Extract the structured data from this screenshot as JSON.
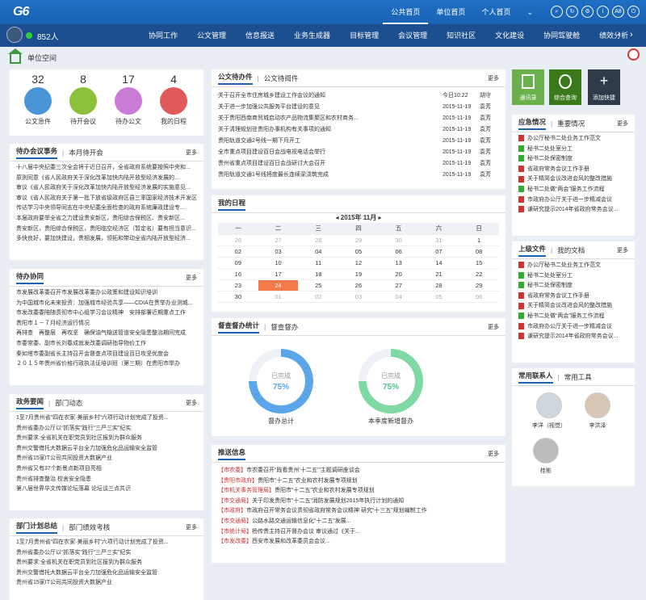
{
  "top": {
    "logo": "G6",
    "nav": [
      "公共首页",
      "单位首页",
      "个人首页"
    ],
    "icons": [
      "search-icon",
      "refresh-icon",
      "settings-icon",
      "info-icon",
      "font-size-icon",
      "power-icon"
    ],
    "icon_text": [
      "A8"
    ]
  },
  "menu": {
    "user": "852人",
    "items": [
      "协同工作",
      "公文管理",
      "信息报送",
      "业务生成器",
      "目标管理",
      "会议管理",
      "知识社区",
      "文化建设",
      "协同驾驶舱",
      "绩效分析"
    ]
  },
  "page_title": "单位空间",
  "stats": [
    {
      "num": "32",
      "label": "公文急件"
    },
    {
      "num": "8",
      "label": "待开会议"
    },
    {
      "num": "17",
      "label": "待办公文"
    },
    {
      "num": "4",
      "label": "我的日程"
    }
  ],
  "meeting": {
    "tab1": "待办会议事务",
    "tab2": "本月待开会",
    "more": "更多",
    "items": [
      "十八届中央纪委三次全会将于近日召开，全省政府系统要按照中央和...",
      "原则同意《省人民政府关于深化改革加快内陆开放型经济发展的...",
      "审议《省人民政府关于深化改革加快内陆开放型经济发展的实施意见...",
      "审议《省人民政府关于第一批下放省级政府区县三率国家经济技术开发区...",
      "传达学习中央领导同志在中央纪委全面检查的政府系统廉政建设专...",
      "本届政府要举全省之力建设贵安新区，贵阳综合保税区、贵安新区...",
      "贵安新区，贵阳综合保税区，贵阳临空经济区（暂定名）要有担当意识...",
      "多快良好，要加快建设，贵相发展，领拓和带动全省内陆开放型经济..."
    ]
  },
  "collab": {
    "tab1": "待办协同",
    "more": "更多",
    "items": [
      "市发展改革委召开市发展改革委办公政策和建设知识培训",
      "为中国城市化未来投资：加强城市经验共享——CDIA在贵举办业测城...",
      "市发改委委陪随贯彻市中心组学习会议精神　安排部署近期重点工作",
      "贵阳市１－７月经济运行情况",
      "再排查　再整层　再攻坚　确保油气输送管道安全隐患整治期间完成",
      "市委常委、副市长刘春成就发改委调研指导物价工作",
      "秦如塔市委副省长主持召开会督查点项目建设百日攻坚优度会",
      "２０１５年贵州省价格行政执法证培训班（第三期）在贵阳市举办"
    ]
  },
  "gov": {
    "tab1": "政务要闻",
    "tab2": "部门动态",
    "more": "更多",
    "items": [
      "1至7月贵州省“四在农家·美丽乡村”六项行动计划完成了投资...",
      "贵州省委办公厅以“抓落实”践行“三严三实”纪实",
      "贵州要求:全省机关在职党员到社区报到为群众服务",
      "贵州交警借托大数据云平台全力加强危化品运输安全监管",
      "贵州省15家IT公司共同投资大数据产业",
      "贵州省又有37个新景点新项目亮相",
      "贵州省排查整治 校舍安全隐患",
      "第八届世界华文传媒论坛落幕 论坛谈三点共识"
    ]
  },
  "dept": {
    "tab1": "部门计划总结",
    "tab2": "部门绩效考核",
    "more": "更多",
    "items": [
      "1至7月贵州省“四在农家·美丽乡村”六项行动计划完成了投资...",
      "贵州省委办公厅以“抓落实”践行“三严三实”纪实",
      "贵州要求:全省机关在职党员到社区报到为群众服务",
      "贵州交警借托大数据云平台全力加强危化品运输安全监管",
      "贵州省15家IT公司共同投资大数据产业"
    ]
  },
  "docs": {
    "tab1": "公文待办件",
    "tab2": "公文待阅件",
    "more": "更多",
    "rows": [
      [
        "关于召开全市住房城乡建设工作会议的通知",
        "今日10:22",
        "胡守"
      ],
      [
        "关于进一步加强公共服务平台建设的意见",
        "2015-11-19",
        "袁芳"
      ],
      [
        "关于贵阳西南商贸城启动农产品物流集聚区和农村商务...",
        "2015-11-19",
        "袁芳"
      ],
      [
        "关于清理规划驻贵阳办事机构有关事项的通知",
        "2015-11-19",
        "袁芳"
      ],
      [
        "贵阳轨道交通2号线一期下月开工",
        "2015-11-19",
        "袁芳"
      ],
      [
        "全市重点项目建设百日会战电视电话会举行",
        "2015-11-19",
        "袁芳"
      ],
      [
        "贵州省重点项目建设百日会战研讨大会召开",
        "2015-11-19",
        "袁芳"
      ],
      [
        "贵阳轨道交通1号线将度最长连续梁浇筑完成",
        "2015-11-19",
        "袁芳"
      ]
    ]
  },
  "calendar": {
    "title": "我的日程",
    "month": "2015年 11月",
    "days": [
      "一",
      "二",
      "三",
      "四",
      "五",
      "六",
      "日"
    ],
    "weeks": [
      [
        "26",
        "27",
        "28",
        "29",
        "30",
        "31",
        "1"
      ],
      [
        "02",
        "03",
        "04",
        "05",
        "06",
        "07",
        "08"
      ],
      [
        "09",
        "10",
        "11",
        "12",
        "13",
        "14",
        "15"
      ],
      [
        "16",
        "17",
        "18",
        "19",
        "20",
        "21",
        "22"
      ],
      [
        "23",
        "24",
        "25",
        "26",
        "27",
        "28",
        "29"
      ],
      [
        "30",
        "01",
        "02",
        "03",
        "04",
        "05",
        "06"
      ]
    ]
  },
  "supervise": {
    "tab1": "督查督办统计",
    "tab2": "督查督办",
    "more": "更多",
    "r1": {
      "status": "已完成",
      "pct": "75%",
      "label": "督办总计"
    },
    "r2": {
      "status": "已完成",
      "pct": "75%",
      "label": "本季度新增督办"
    }
  },
  "push": {
    "title": "推送信息",
    "more": "更多",
    "items": [
      [
        "【市农委】",
        "市农委召开“践看贵州‘十二五’”主题调研座谈会"
      ],
      [
        "【贵阳市政府】",
        "贵阳市“十二五”农业和农村发展专项规划"
      ],
      [
        "【市机关事务管理局】",
        "贵阳市“十二五”农业和农村发展专项规划"
      ],
      [
        "【市交通局】",
        "关于印发贵阳市“十二五”消防发展规划2015年执行计划的通知"
      ],
      [
        "【市政府】",
        "市政府召开常务会议贯彻省政府常务会议精神 研究“十三五”规划编制工作"
      ],
      [
        "【市交通局】",
        "公路水路交通运输信息化“十二五”发展..."
      ],
      [
        "【市统计局】",
        "杨传贵主持召开督办会议 审议通过《关于..."
      ],
      [
        "【市发改委】",
        "西安市发展和改革委员会会议..."
      ]
    ]
  },
  "quick": [
    {
      "label": "通讯录"
    },
    {
      "label": "综合查询"
    },
    {
      "label": "添加快捷"
    }
  ],
  "emergency": {
    "tab1": "应急情况",
    "tab2": "重要情况",
    "more": "更多",
    "items": [
      "办公厅秘书二处业务工作范文",
      "秘书二处处室分工",
      "秘书二处保密制度",
      "省政府常务会议工作手册",
      "关于精简会议改进会风的整改措施",
      "秘书二处做“两会”服务工作流程",
      "市政府办公厅关于进一步精减会议",
      "谦研究提示2014年省政府常务会议..."
    ]
  },
  "superior": {
    "tab1": "上级文件",
    "tab2": "我的文档",
    "more": "更多",
    "items": [
      "办公厅秘书二处业务工作范文",
      "秘书二处处室分工",
      "秘书二处保密制度",
      "省政府常务会议工作手册",
      "关于精简会议改进会风的整改措施",
      "秘书二处做“两会”服务工作流程",
      "市政府办公厅关于进一步精减会议",
      "谦研究提示2014年省政府常务会议..."
    ]
  },
  "contacts": {
    "tab1": "常用联系人",
    "tab2": "常用工具",
    "people": [
      "李洋（视觉）",
      "李洪泽",
      "桂彬"
    ]
  }
}
